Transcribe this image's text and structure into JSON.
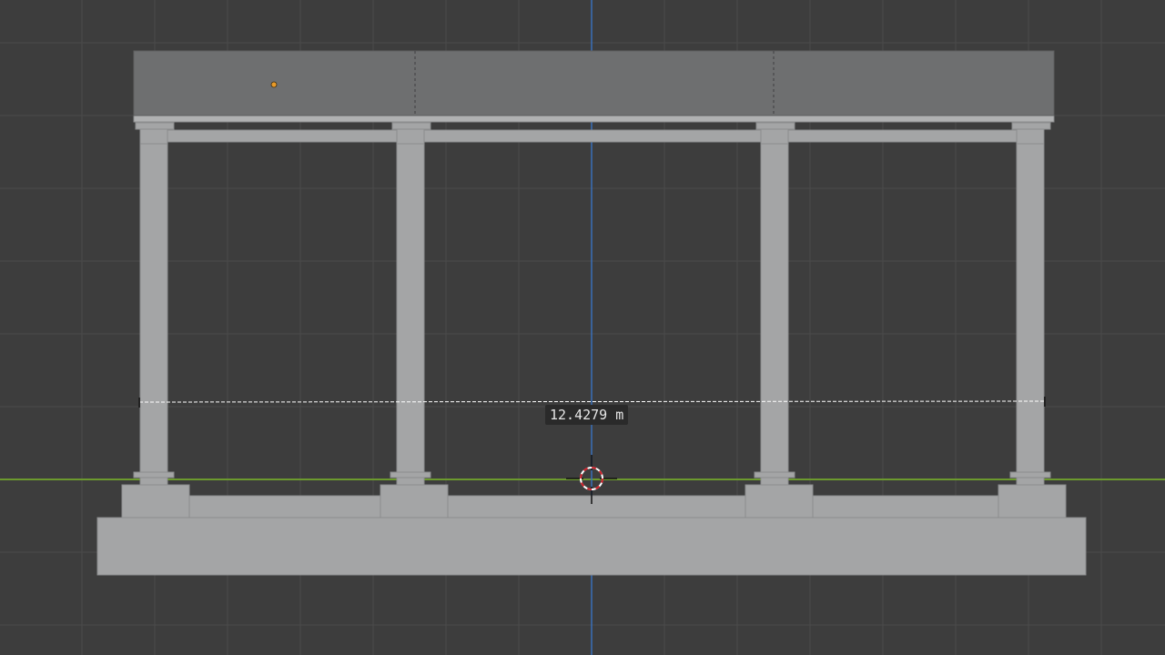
{
  "viewport": {
    "background_color": "#3d3d3d",
    "grid_color": "#4a4a4a",
    "x_axis_color": "#6c9a2e",
    "y_axis_color": "#3a6fb8",
    "mesh_color": "#a4a5a6",
    "mesh_dark_color": "#6e6f70",
    "origin_point_color": "#e89a28"
  },
  "measurement": {
    "value": "12.4279 m",
    "line_color": "#ffffff",
    "label_background": "#2a2a2a"
  },
  "cursor_3d": {
    "icon": "3d-cursor-icon"
  }
}
